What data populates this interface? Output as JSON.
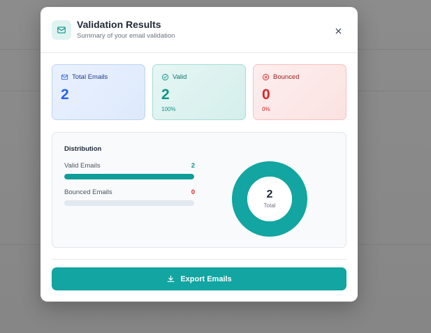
{
  "header": {
    "title": "Validation Results",
    "subtitle": "Summary of your email validation",
    "icon": "mail-icon",
    "close_icon": "close-icon"
  },
  "cards": {
    "total": {
      "label": "Total Emails",
      "value": "2",
      "icon": "mail-icon",
      "color": "#2563eb"
    },
    "valid": {
      "label": "Valid",
      "value": "2",
      "percent": "100%",
      "icon": "check-circle-icon",
      "color": "#0d9488"
    },
    "bounced": {
      "label": "Bounced",
      "value": "0",
      "percent": "0%",
      "icon": "x-circle-icon",
      "color": "#dc2626"
    }
  },
  "distribution": {
    "title": "Distribution",
    "rows": [
      {
        "label": "Valid Emails",
        "count": "2",
        "fraction": 1.0,
        "color": "#0f9d98"
      },
      {
        "label": "Bounced Emails",
        "count": "0",
        "fraction": 0.0,
        "color": "#dc2626"
      }
    ],
    "donut": {
      "total": "2",
      "label": "Total",
      "ring_color": "#12a5a1"
    }
  },
  "actions": {
    "export_label": "Export Emails",
    "export_icon": "download-icon"
  }
}
